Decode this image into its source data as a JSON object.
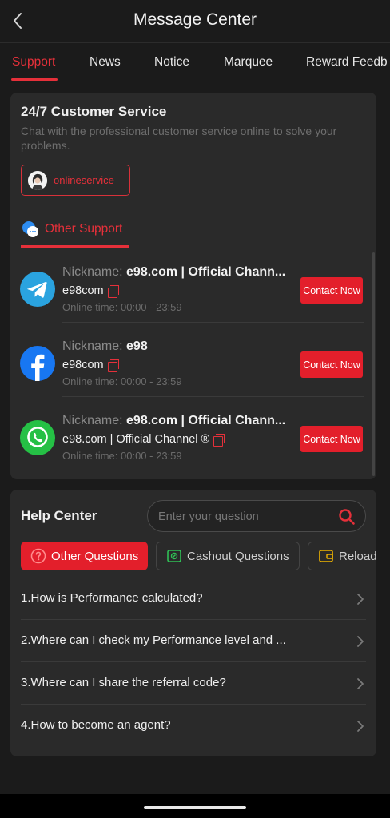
{
  "header": {
    "title": "Message Center",
    "back_icon": "chevron-left-icon"
  },
  "tabs": [
    {
      "label": "Support",
      "active": true
    },
    {
      "label": "News"
    },
    {
      "label": "Notice"
    },
    {
      "label": "Marquee"
    },
    {
      "label": "Reward Feedb"
    }
  ],
  "customer_service": {
    "title": "24/7 Customer Service",
    "subtitle": "Chat with the professional customer service online to solve your problems.",
    "online_button": "onlineservice",
    "other_support_tab": "Other Support"
  },
  "support_items": [
    {
      "icon": "telegram-icon",
      "nickname_label": "Nickname:",
      "nickname": "e98.com | Official Chann...",
      "account": "e98com",
      "online_label": "Online time:",
      "online_time": "00:00 - 23:59",
      "contact_label": "Contact Now"
    },
    {
      "icon": "facebook-icon",
      "nickname_label": "Nickname:",
      "nickname": "e98",
      "account": "e98com",
      "online_label": "Online time:",
      "online_time": "00:00 - 23:59",
      "contact_label": "Contact Now"
    },
    {
      "icon": "whatsapp-icon",
      "nickname_label": "Nickname:",
      "nickname": "e98.com | Official Chann...",
      "account": "e98.com | Official Channel ®",
      "online_label": "Online time:",
      "online_time": "00:00 - 23:59",
      "contact_label": "Contact Now"
    }
  ],
  "help": {
    "title": "Help Center",
    "search_placeholder": "Enter your question",
    "categories": [
      {
        "label": "Other Questions",
        "active": true
      },
      {
        "label": "Cashout Questions"
      },
      {
        "label": "Reload"
      }
    ],
    "questions": [
      "1.How is Performance calculated?",
      "2.Where can I check my Performance level and ...",
      "3.Where can I share the referral code?",
      "4.How to become an agent?"
    ]
  },
  "colors": {
    "accent": "#e5303a",
    "button_red": "#e31f2b",
    "background": "#1b1b1b",
    "card": "#2a2a2a",
    "telegram": "#2aa3df",
    "facebook": "#1877f2",
    "whatsapp": "#25c045"
  }
}
